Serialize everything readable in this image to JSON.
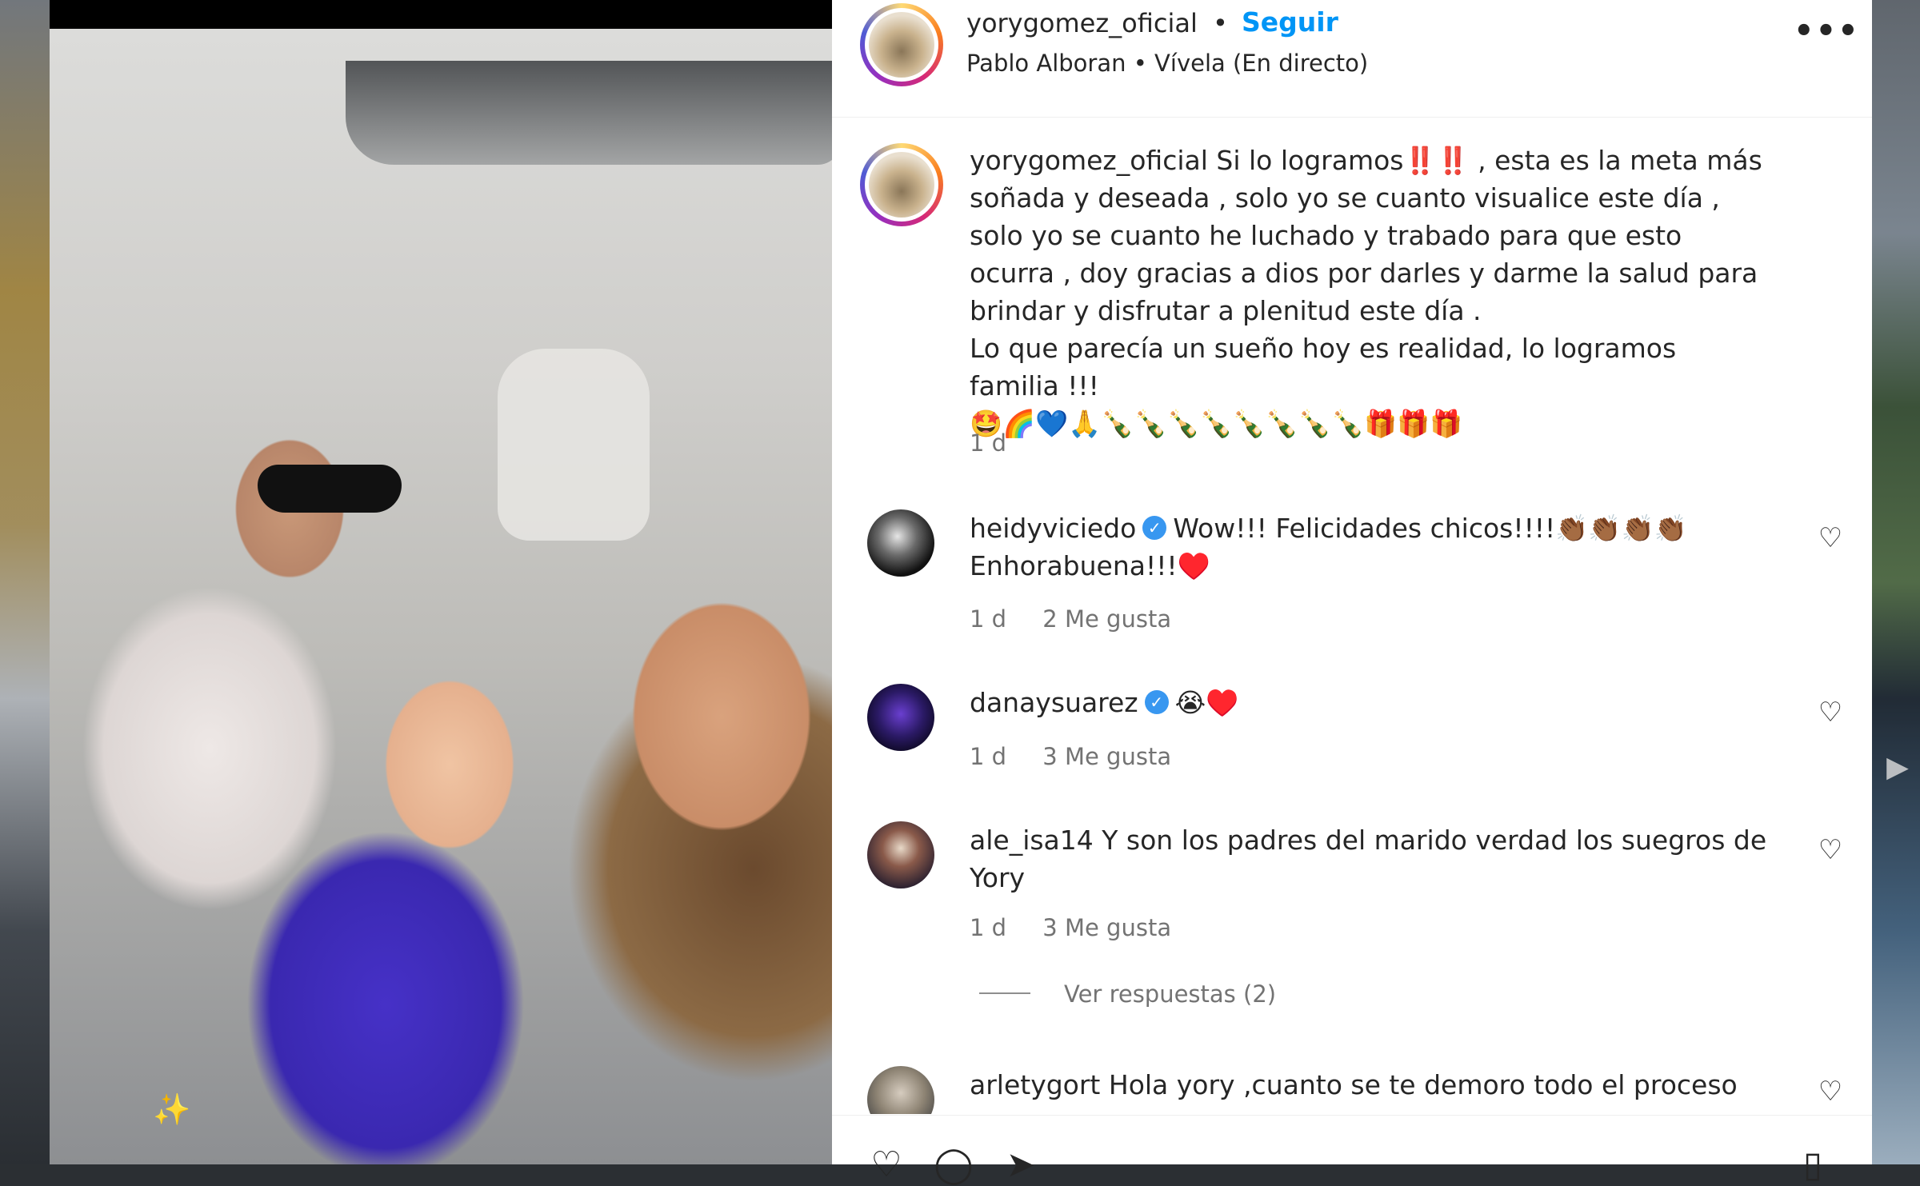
{
  "post": {
    "username": "yorygomez_oficial",
    "separator": "•",
    "follow_label": "Seguir",
    "audio": "Pablo Alboran • Vívela (En directo)",
    "more_label": "•••"
  },
  "caption": {
    "username": "yorygomez_oficial",
    "text_line1": "Si lo logramos‼️‼️ , esta es la meta más soñada y deseada , solo yo se cuanto visualice este día , solo yo se cuanto he luchado y trabado para que esto ocurra , doy gracias a dios por darles y darme la salud para brindar y disfrutar a plenitud este día .",
    "text_line2": "Lo que parecía un sueño hoy es realidad, lo logramos familia !!!",
    "emojis": "🤩🌈💙🙏🍾🍾🍾🍾🍾🍾🍾🍾🎁🎁🎁",
    "time": "1 d"
  },
  "comments": [
    {
      "username": "heidyviciedo",
      "verified": true,
      "text": "Wow!!! Felicidades chicos!!!!👏🏾👏🏾👏🏾👏🏾 Enhorabuena!!!♥️",
      "time": "1 d",
      "likes": "2 Me gusta"
    },
    {
      "username": "danaysuarez",
      "verified": true,
      "text": "😭♥️",
      "time": "1 d",
      "likes": "3 Me gusta"
    },
    {
      "username": "ale_isa14",
      "verified": false,
      "text": "Y son los padres del marido verdad los suegros de Yory",
      "time": "1 d",
      "likes": "3 Me gusta"
    },
    {
      "username": "arletygort",
      "verified": false,
      "text": "Hola yory ,cuanto se te demoro todo el proceso"
    }
  ],
  "view_replies": "Ver respuestas (2)",
  "icons": {
    "verified": "verified-badge-icon",
    "heart": "heart-outline-icon",
    "more": "more-horizontal-icon",
    "magic": "magic-wand-icon",
    "reels": "reels-icon"
  },
  "colors": {
    "follow": "#0095f6",
    "verified": "#3897f0",
    "muted": "#737373"
  }
}
